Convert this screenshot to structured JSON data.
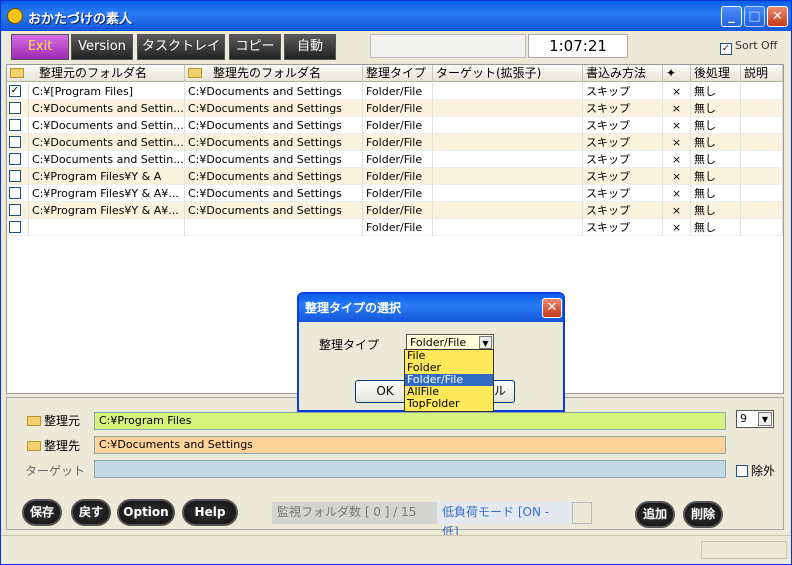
{
  "window": {
    "title": "おかたづけの素人"
  },
  "toolbar": {
    "buttons": [
      "Exit",
      "Version",
      "タスクトレイ",
      "コピー",
      "自動"
    ],
    "clock": "1:07:21",
    "sort_label": "Sort Off",
    "sort_checked": true
  },
  "grid": {
    "columns": [
      "整理元のフォルダ名",
      "整理先のフォルダ名",
      "整理タイプ",
      "ターゲット(拡張子)",
      "書込み方法",
      "",
      "後処理",
      "説明"
    ],
    "rows": [
      {
        "checked": true,
        "src": "C:¥[Program Files]",
        "dst": "C:¥Documents and Settings",
        "type": "Folder/File",
        "target": "",
        "write": "スキップ",
        "mark": "×",
        "post": "無し"
      },
      {
        "checked": false,
        "src": "C:¥Documents and Settin...",
        "dst": "C:¥Documents and Settings",
        "type": "Folder/File",
        "target": "",
        "write": "スキップ",
        "mark": "×",
        "post": "無し"
      },
      {
        "checked": false,
        "src": "C:¥Documents and Settin...",
        "dst": "C:¥Documents and Settings",
        "type": "Folder/File",
        "target": "",
        "write": "スキップ",
        "mark": "×",
        "post": "無し"
      },
      {
        "checked": false,
        "src": "C:¥Documents and Settin...",
        "dst": "C:¥Documents and Settings",
        "type": "Folder/File",
        "target": "",
        "write": "スキップ",
        "mark": "×",
        "post": "無し"
      },
      {
        "checked": false,
        "src": "C:¥Documents and Settin...",
        "dst": "C:¥Documents and Settings",
        "type": "Folder/File",
        "target": "",
        "write": "スキップ",
        "mark": "×",
        "post": "無し"
      },
      {
        "checked": false,
        "src": "C:¥Program Files¥Y & A",
        "dst": "C:¥Documents and Settings",
        "type": "Folder/File",
        "target": "",
        "write": "スキップ",
        "mark": "×",
        "post": "無し"
      },
      {
        "checked": false,
        "src": "C:¥Program Files¥Y & A¥...",
        "dst": "C:¥Documents and Settings",
        "type": "Folder/File",
        "target": "",
        "write": "スキップ",
        "mark": "×",
        "post": "無し"
      },
      {
        "checked": false,
        "src": "C:¥Program Files¥Y & A¥...",
        "dst": "C:¥Documents and Settings",
        "type": "Folder/File",
        "target": "",
        "write": "スキップ",
        "mark": "×",
        "post": "無し"
      },
      {
        "checked": false,
        "src": "",
        "dst": "",
        "type": "Folder/File",
        "target": "",
        "write": "スキップ",
        "mark": "×",
        "post": "無し"
      }
    ]
  },
  "form": {
    "src_label": "整理元",
    "src_value": "C:¥Program Files",
    "dst_label": "整理先",
    "dst_value": "C:¥Documents and Settings",
    "target_label": "ターゲット",
    "target_value": "",
    "count_select": "9",
    "exclude_label": "除外"
  },
  "actions": {
    "buttons": [
      "保存",
      "戻す",
      "Option",
      "Help"
    ],
    "monitor": "監視フォルダ数 [ 0 ] / 15",
    "low_load": "低負荷モード [ON - 低]",
    "add": "追加",
    "delete": "削除"
  },
  "dialog": {
    "title": "整理タイプの選択",
    "label": "整理タイプ",
    "selected": "Folder/File",
    "ok": "OK",
    "cancel_partial": "ル",
    "options": [
      "File",
      "Folder",
      "Folder/File",
      "AllFile",
      "TopFolder"
    ]
  },
  "colors": {
    "src_field": "#d7f27d",
    "dst_field": "#ffd49a",
    "target_field": "#c4d9e6"
  }
}
